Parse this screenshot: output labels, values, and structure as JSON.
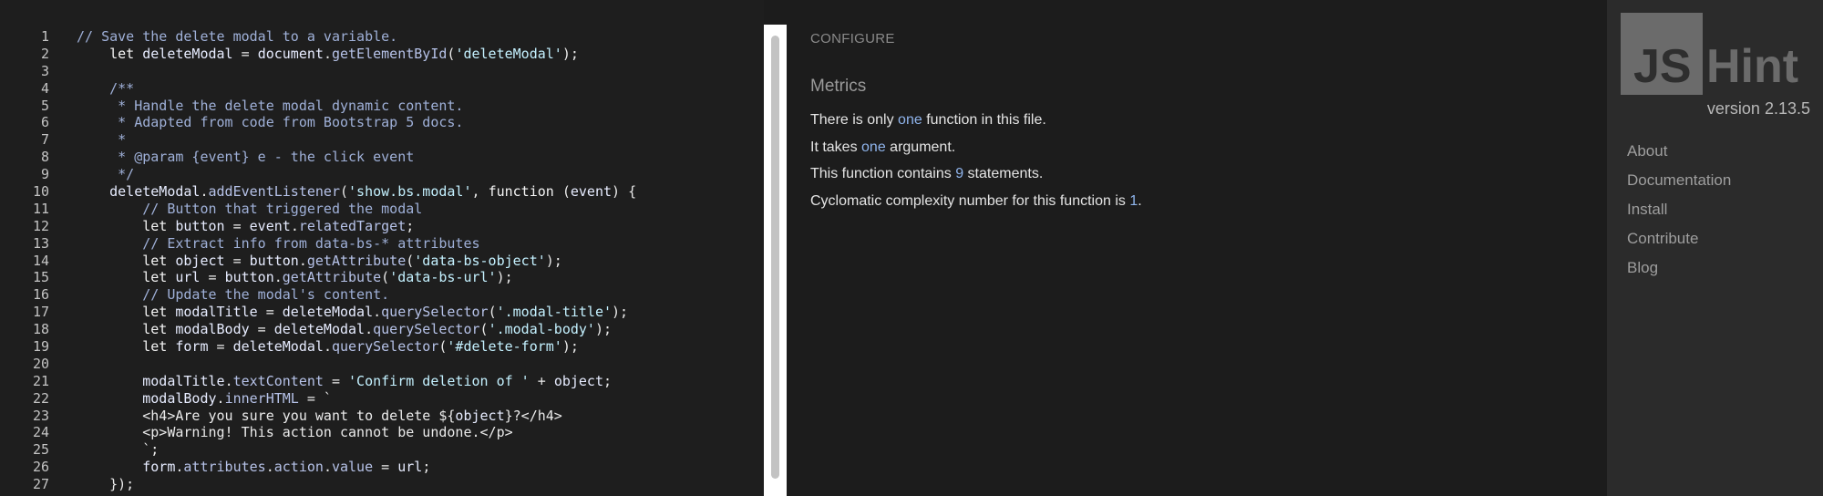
{
  "editor": {
    "line_numbers": [
      "1",
      "2",
      "3",
      "4",
      "5",
      "6",
      "7",
      "8",
      "9",
      "10",
      "11",
      "12",
      "13",
      "14",
      "15",
      "16",
      "17",
      "18",
      "19",
      "20",
      "21",
      "22",
      "23",
      "24",
      "25",
      "26",
      "27"
    ],
    "lines": [
      [
        {
          "t": "cm",
          "v": "// Save the delete modal to a variable."
        }
      ],
      [
        {
          "t": "",
          "v": "    "
        },
        {
          "t": "kw",
          "v": "let "
        },
        {
          "t": "vr",
          "v": "deleteModal"
        },
        {
          "t": "",
          "v": " = "
        },
        {
          "t": "vr",
          "v": "document"
        },
        {
          "t": "",
          "v": "."
        },
        {
          "t": "fn",
          "v": "getElementById"
        },
        {
          "t": "",
          "v": "("
        },
        {
          "t": "st",
          "v": "'deleteModal'"
        },
        {
          "t": "",
          "v": ");"
        }
      ],
      [
        {
          "t": "",
          "v": ""
        }
      ],
      [
        {
          "t": "cm",
          "v": "    /**"
        }
      ],
      [
        {
          "t": "cm",
          "v": "     * Handle the delete modal dynamic content."
        }
      ],
      [
        {
          "t": "cm",
          "v": "     * Adapted from code from Bootstrap 5 docs."
        }
      ],
      [
        {
          "t": "cm",
          "v": "     *"
        }
      ],
      [
        {
          "t": "cm",
          "v": "     * @param {event} e - the click event"
        }
      ],
      [
        {
          "t": "cm",
          "v": "     */"
        }
      ],
      [
        {
          "t": "",
          "v": "    "
        },
        {
          "t": "vr",
          "v": "deleteModal"
        },
        {
          "t": "",
          "v": "."
        },
        {
          "t": "fn",
          "v": "addEventListener"
        },
        {
          "t": "",
          "v": "("
        },
        {
          "t": "st",
          "v": "'show.bs.modal'"
        },
        {
          "t": "",
          "v": ", "
        },
        {
          "t": "kw",
          "v": "function"
        },
        {
          "t": "",
          "v": " ("
        },
        {
          "t": "vr",
          "v": "event"
        },
        {
          "t": "",
          "v": ") {"
        }
      ],
      [
        {
          "t": "cm",
          "v": "        // Button that triggered the modal"
        }
      ],
      [
        {
          "t": "",
          "v": "        "
        },
        {
          "t": "kw",
          "v": "let "
        },
        {
          "t": "vr",
          "v": "button"
        },
        {
          "t": "",
          "v": " = "
        },
        {
          "t": "vr",
          "v": "event"
        },
        {
          "t": "",
          "v": "."
        },
        {
          "t": "fn",
          "v": "relatedTarget"
        },
        {
          "t": "",
          "v": ";"
        }
      ],
      [
        {
          "t": "cm",
          "v": "        // Extract info from data-bs-* attributes"
        }
      ],
      [
        {
          "t": "",
          "v": "        "
        },
        {
          "t": "kw",
          "v": "let "
        },
        {
          "t": "vr",
          "v": "object"
        },
        {
          "t": "",
          "v": " = "
        },
        {
          "t": "vr",
          "v": "button"
        },
        {
          "t": "",
          "v": "."
        },
        {
          "t": "fn",
          "v": "getAttribute"
        },
        {
          "t": "",
          "v": "("
        },
        {
          "t": "st",
          "v": "'data-bs-object'"
        },
        {
          "t": "",
          "v": ");"
        }
      ],
      [
        {
          "t": "",
          "v": "        "
        },
        {
          "t": "kw",
          "v": "let "
        },
        {
          "t": "vr",
          "v": "url"
        },
        {
          "t": "",
          "v": " = "
        },
        {
          "t": "vr",
          "v": "button"
        },
        {
          "t": "",
          "v": "."
        },
        {
          "t": "fn",
          "v": "getAttribute"
        },
        {
          "t": "",
          "v": "("
        },
        {
          "t": "st",
          "v": "'data-bs-url'"
        },
        {
          "t": "",
          "v": ");"
        }
      ],
      [
        {
          "t": "cm",
          "v": "        // Update the modal's content."
        }
      ],
      [
        {
          "t": "",
          "v": "        "
        },
        {
          "t": "kw",
          "v": "let "
        },
        {
          "t": "vr",
          "v": "modalTitle"
        },
        {
          "t": "",
          "v": " = "
        },
        {
          "t": "vr",
          "v": "deleteModal"
        },
        {
          "t": "",
          "v": "."
        },
        {
          "t": "fn",
          "v": "querySelector"
        },
        {
          "t": "",
          "v": "("
        },
        {
          "t": "st",
          "v": "'.modal-title'"
        },
        {
          "t": "",
          "v": ");"
        }
      ],
      [
        {
          "t": "",
          "v": "        "
        },
        {
          "t": "kw",
          "v": "let "
        },
        {
          "t": "vr",
          "v": "modalBody"
        },
        {
          "t": "",
          "v": " = "
        },
        {
          "t": "vr",
          "v": "deleteModal"
        },
        {
          "t": "",
          "v": "."
        },
        {
          "t": "fn",
          "v": "querySelector"
        },
        {
          "t": "",
          "v": "("
        },
        {
          "t": "st",
          "v": "'.modal-body'"
        },
        {
          "t": "",
          "v": ");"
        }
      ],
      [
        {
          "t": "",
          "v": "        "
        },
        {
          "t": "kw",
          "v": "let "
        },
        {
          "t": "vr",
          "v": "form"
        },
        {
          "t": "",
          "v": " = "
        },
        {
          "t": "vr",
          "v": "deleteModal"
        },
        {
          "t": "",
          "v": "."
        },
        {
          "t": "fn",
          "v": "querySelector"
        },
        {
          "t": "",
          "v": "("
        },
        {
          "t": "st",
          "v": "'#delete-form'"
        },
        {
          "t": "",
          "v": ");"
        }
      ],
      [
        {
          "t": "",
          "v": ""
        }
      ],
      [
        {
          "t": "",
          "v": "        "
        },
        {
          "t": "vr",
          "v": "modalTitle"
        },
        {
          "t": "",
          "v": "."
        },
        {
          "t": "fn",
          "v": "textContent"
        },
        {
          "t": "",
          "v": " = "
        },
        {
          "t": "st",
          "v": "'Confirm deletion of '"
        },
        {
          "t": "",
          "v": " + "
        },
        {
          "t": "vr",
          "v": "object"
        },
        {
          "t": "",
          "v": ";"
        }
      ],
      [
        {
          "t": "",
          "v": "        "
        },
        {
          "t": "vr",
          "v": "modalBody"
        },
        {
          "t": "",
          "v": "."
        },
        {
          "t": "fn",
          "v": "innerHTML"
        },
        {
          "t": "",
          "v": " = `"
        }
      ],
      [
        {
          "t": "",
          "v": "        <h4>Are you sure you want to delete ${"
        },
        {
          "t": "vr",
          "v": "object"
        },
        {
          "t": "",
          "v": "}?</h4>"
        }
      ],
      [
        {
          "t": "",
          "v": "        <p>Warning! This action cannot be undone.</p>"
        }
      ],
      [
        {
          "t": "",
          "v": "        `;"
        }
      ],
      [
        {
          "t": "",
          "v": "        "
        },
        {
          "t": "vr",
          "v": "form"
        },
        {
          "t": "",
          "v": "."
        },
        {
          "t": "fn",
          "v": "attributes"
        },
        {
          "t": "",
          "v": "."
        },
        {
          "t": "fn",
          "v": "action"
        },
        {
          "t": "",
          "v": "."
        },
        {
          "t": "fn",
          "v": "value"
        },
        {
          "t": "",
          "v": " = "
        },
        {
          "t": "vr",
          "v": "url"
        },
        {
          "t": "",
          "v": ";"
        }
      ],
      [
        {
          "t": "",
          "v": "    });"
        }
      ]
    ]
  },
  "report": {
    "configure_label": "CONFIGURE",
    "metrics_title": "Metrics",
    "metrics": [
      {
        "before": "There is only ",
        "value": "one",
        "after": " function in this file."
      },
      {
        "before": "It takes ",
        "value": "one",
        "after": " argument."
      },
      {
        "before": "This function contains ",
        "value": "9",
        "after": " statements."
      },
      {
        "before": "Cyclomatic complexity number for this function is ",
        "value": "1",
        "after": "."
      }
    ]
  },
  "sidebar": {
    "logo_text_left": "JS",
    "logo_text_right": "Hint",
    "version": "version 2.13.5",
    "nav": [
      "About",
      "Documentation",
      "Install",
      "Contribute",
      "Blog"
    ]
  },
  "colors": {
    "editor_bg": "#1e1e1e",
    "panel_bg": "#1c1c1c",
    "sidebar_bg": "#2b2b2b",
    "highlight": "#8fb4ec",
    "logo_box": "#6b6b6b"
  }
}
